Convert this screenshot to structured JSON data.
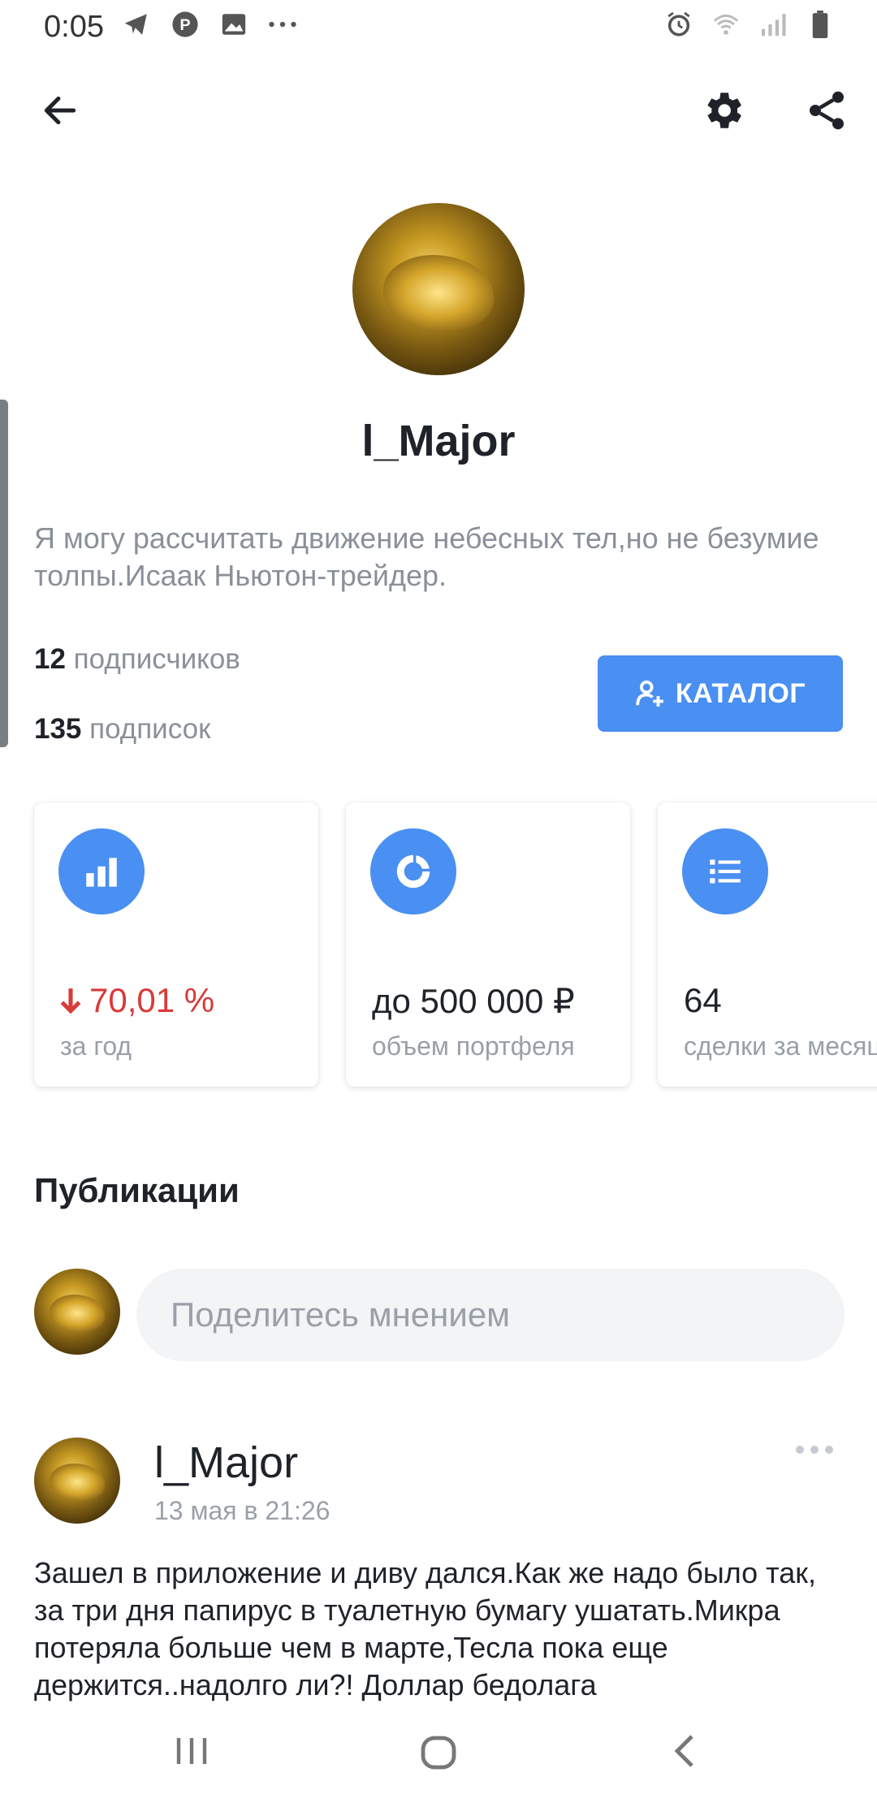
{
  "status_bar": {
    "time": "0:05"
  },
  "profile": {
    "username": "l_Major",
    "bio": "Я могу рассчитать движение небесных тел,но не безумие толпы.Исаак Ньютон-трейдер.",
    "followers_count": "12",
    "followers_label": "подписчиков",
    "following_count": "135",
    "following_label": "подписок",
    "catalog_button": "КАТАЛОГ"
  },
  "stats_cards": [
    {
      "value": "70,01 %",
      "label": "за год",
      "icon": "bar-chart-icon",
      "color": "#d93a3a"
    },
    {
      "value": "до 500 000 ₽",
      "label": "объем портфеля",
      "icon": "pie-chart-icon"
    },
    {
      "value": "64",
      "label": "сделки за месяц",
      "icon": "list-icon"
    }
  ],
  "publications": {
    "title": "Публикации",
    "composer_placeholder": "Поделитесь мнением"
  },
  "post": {
    "author": "l_Major",
    "timestamp": "13 мая в 21:26",
    "text": "Зашел в приложение и диву дался.Как же надо было так, за три дня папирус в туалетную бумагу ушатать.Микра потеряла больше чем в марте,Тесла пока еще держится..надолго ли?! Доллар бедолага"
  },
  "colors": {
    "accent": "#4a8ff2",
    "negative": "#d93a3a",
    "muted": "#9aa0a8"
  }
}
